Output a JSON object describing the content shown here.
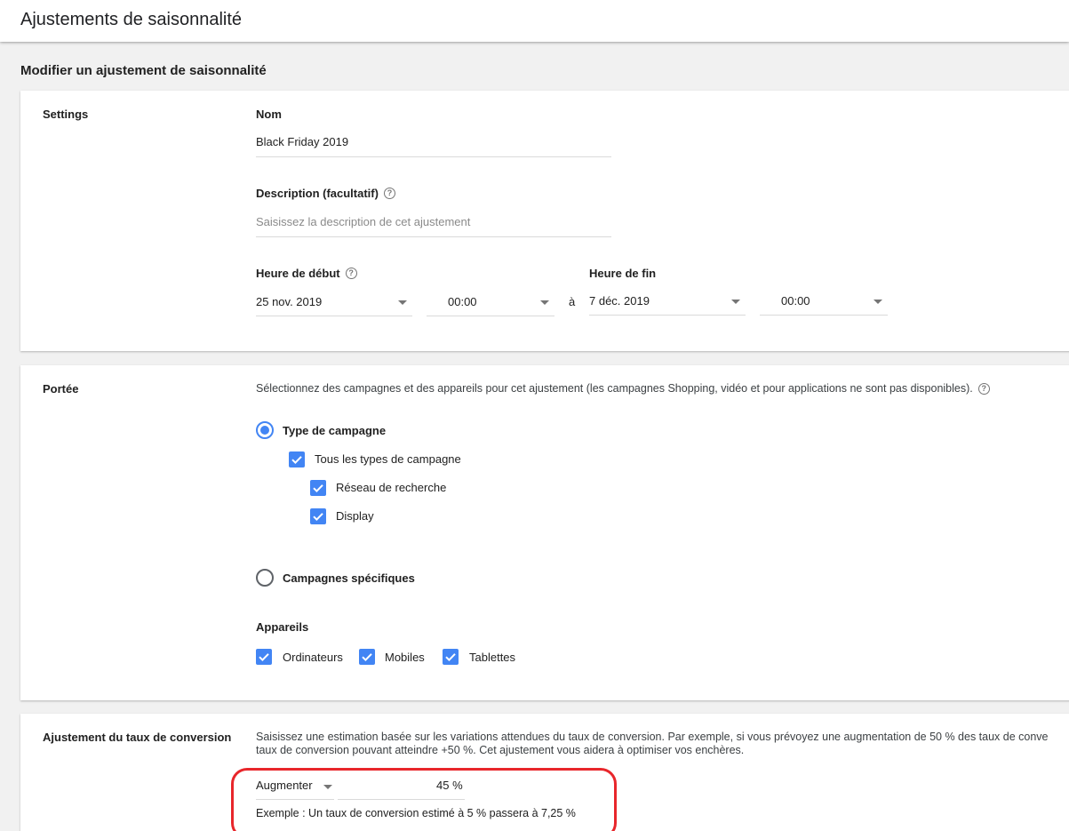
{
  "page": {
    "title": "Ajustements de saisonnalité",
    "subtitle": "Modifier un ajustement de saisonnalité"
  },
  "settings": {
    "section_label": "Settings",
    "name_label": "Nom",
    "name_value": "Black Friday 2019",
    "description_label": "Description (facultatif)",
    "description_placeholder": "Saisissez la description de cet ajustement",
    "start_label": "Heure de début",
    "start_date": "25 nov. 2019",
    "start_time": "00:00",
    "to_separator": "à",
    "end_label": "Heure de fin",
    "end_date": "7 déc. 2019",
    "end_time": "00:00",
    "help_icon": "?"
  },
  "scope": {
    "section_label": "Portée",
    "description": "Sélectionnez des campagnes et des appareils pour cet ajustement (les campagnes Shopping, vidéo et pour applications ne sont pas disponibles).",
    "campaign_type_label": "Type de campagne",
    "all_types_label": "Tous les types de campagne",
    "search_network_label": "Réseau de recherche",
    "display_label": "Display",
    "specific_campaigns_label": "Campagnes spécifiques",
    "devices_label": "Appareils",
    "devices": [
      "Ordinateurs",
      "Mobiles",
      "Tablettes"
    ]
  },
  "conversion": {
    "section_label": "Ajustement du taux de conversion",
    "description_line1": "Saisissez une estimation basée sur les variations attendues du taux de conversion. Par exemple, si vous prévoyez une augmentation de 50 % des taux de conve",
    "description_line2": "taux de conversion pouvant atteindre +50 %. Cet ajustement vous aidera à optimiser vos enchères.",
    "direction_value": "Augmenter",
    "percent_value": "45 %",
    "example_text": "Exemple : Un taux de conversion estimé à 5 % passera à 7,25 %"
  },
  "colors": {
    "accent": "#4285f4",
    "highlight": "#e8262b"
  }
}
